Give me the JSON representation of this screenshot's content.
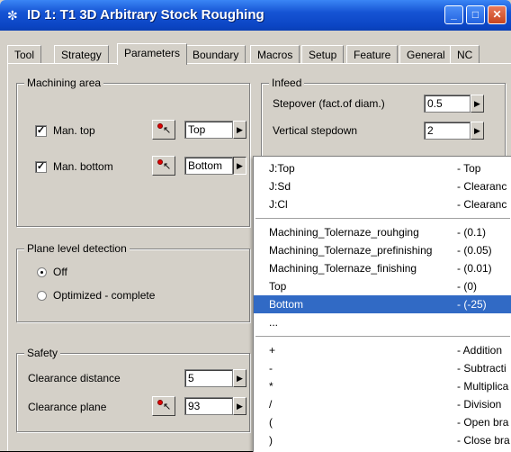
{
  "window": {
    "title": "ID 1: T1 3D Arbitrary Stock Roughing",
    "icon": "tool-icon"
  },
  "tabs": [
    "Tool",
    "Strategy",
    "Parameters",
    "Boundary",
    "Macros",
    "Setup",
    "Feature",
    "General",
    "NC"
  ],
  "active_tab": "Parameters",
  "machining_area": {
    "legend": "Machining area",
    "man_top": {
      "label": "Man. top",
      "checked": true,
      "value": "Top"
    },
    "man_bottom": {
      "label": "Man. bottom",
      "checked": true,
      "value": "Bottom"
    }
  },
  "infeed": {
    "legend": "Infeed",
    "stepover": {
      "label": "Stepover (fact.of diam.)",
      "value": "0.5"
    },
    "vertical_stepdown": {
      "label": "Vertical stepdown",
      "value": "2"
    }
  },
  "plane_level": {
    "legend": "Plane level detection",
    "options": [
      "Off",
      "Optimized - complete"
    ],
    "selected": "Off"
  },
  "safety": {
    "legend": "Safety",
    "clearance_distance": {
      "label": "Clearance distance",
      "value": "5"
    },
    "clearance_plane": {
      "label": "Clearance plane",
      "value": "93"
    }
  },
  "menu": {
    "variables": [
      {
        "name": "J:Top",
        "desc": "- Top"
      },
      {
        "name": "J:Sd",
        "desc": "- Clearanc"
      },
      {
        "name": "J:Cl",
        "desc": "- Clearanc"
      }
    ],
    "parameters": [
      {
        "name": "Machining_Tolernaze_rouhging",
        "desc": "- (0.1)"
      },
      {
        "name": "Machining_Tolernaze_prefinishing",
        "desc": "- (0.05)"
      },
      {
        "name": "Machining_Tolernaze_finishing",
        "desc": "- (0.01)"
      },
      {
        "name": "Top",
        "desc": "- (0)"
      },
      {
        "name": "Bottom",
        "desc": "- (-25)"
      },
      {
        "name": "...",
        "desc": ""
      }
    ],
    "selected": "Bottom",
    "operators": [
      {
        "name": "+",
        "desc": "- Addition"
      },
      {
        "name": "-",
        "desc": "- Subtracti"
      },
      {
        "name": "*",
        "desc": "- Multiplica"
      },
      {
        "name": "/",
        "desc": "- Division"
      },
      {
        "name": "(",
        "desc": "- Open bra"
      },
      {
        "name": ")",
        "desc": "- Close bra"
      }
    ]
  }
}
